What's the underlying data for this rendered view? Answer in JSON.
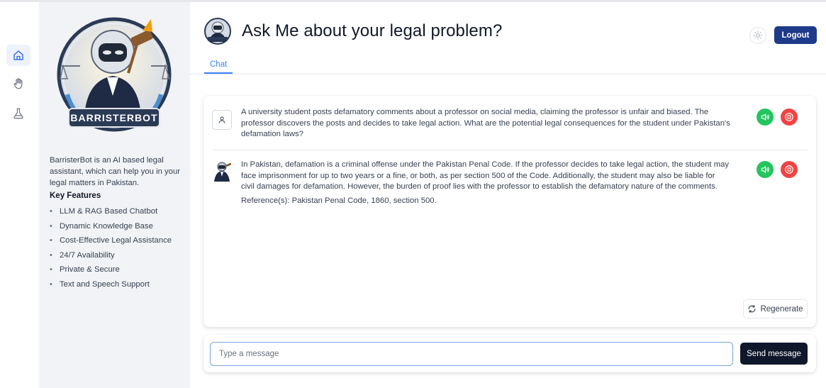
{
  "app": {
    "brand": "BARRISTERBOT",
    "title": "Ask Me about your legal problem?",
    "logout_label": "Logout",
    "tabs": [
      {
        "label": "Chat",
        "active": true
      }
    ]
  },
  "rail": {
    "items": [
      {
        "icon": "home-icon",
        "active": true
      },
      {
        "icon": "hand-icon",
        "active": false
      },
      {
        "icon": "flask-icon",
        "active": false
      }
    ]
  },
  "sidebar": {
    "description": "BarristerBot is an AI based legal assistant, which can help you in your legal matters in Pakistan.",
    "features_title": "Key Features",
    "features": [
      "LLM & RAG Based Chatbot",
      "Dynamic Knowledge Base",
      "Cost-Effective Legal Assistance",
      "24/7 Availability",
      "Private & Secure",
      "Text and Speech Support"
    ]
  },
  "chat": {
    "messages": [
      {
        "role": "user",
        "text": "A university student posts defamatory comments about a professor on social media, claiming the professor is unfair and biased. The professor discovers the posts and decides to take legal action. What are the potential legal consequences for the student under Pakistan's defamation laws?"
      },
      {
        "role": "bot",
        "text": "In Pakistan, defamation is a criminal offense under the Pakistan Penal Code. If the professor decides to take legal action, the student may face imprisonment for up to two years or a fine, or both, as per section 500 of the Code. Additionally, the student may also be liable for civil damages for defamation. However, the burden of proof lies with the professor to establish the defamatory nature of the comments.",
        "reference": "Reference(s): Pakistan Penal Code, 1860, section 500."
      }
    ],
    "regenerate_label": "Regenerate"
  },
  "composer": {
    "placeholder": "Type a message",
    "value": "",
    "send_label": "Send message"
  },
  "colors": {
    "accent": "#1e3a8a",
    "tab_active": "#3b82f6",
    "speak": "#22c55e",
    "stop": "#ef4444",
    "send": "#0f172a"
  }
}
